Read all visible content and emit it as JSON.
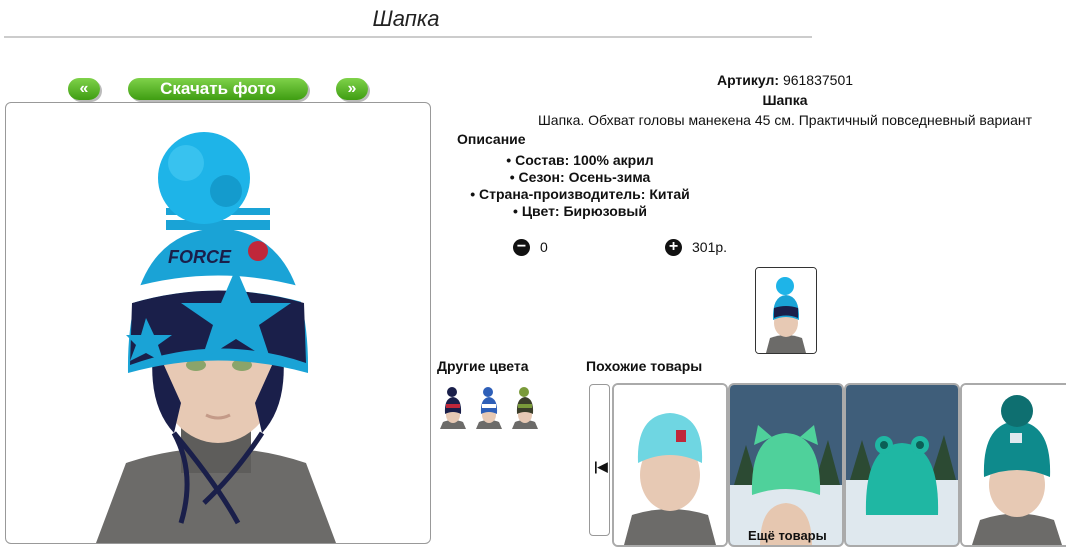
{
  "page": {
    "title": "Шапка"
  },
  "toolbar": {
    "prev_label": "«",
    "download_label": "Скачать фото",
    "next_label": "»"
  },
  "product": {
    "sku_label": "Артикул:",
    "sku_value": "961837501",
    "name": "Шапка",
    "description": "Шапка. Обхват головы манекена 45 см. Практичный повседневный вариант",
    "desc_heading": "Описание",
    "specs": [
      "Состав: 100% акрил",
      "Сезон: Осень-зима",
      "Страна-производитель: Китай",
      "Цвет: Бирюзовый"
    ],
    "quantity": "0",
    "price": "301р.",
    "hat_logo_text": "FORCE",
    "colors": {
      "hat_turquoise": "#1aa3d6",
      "hat_navy": "#1a1f4a"
    }
  },
  "other_colors": {
    "heading": "Другие цвета",
    "swatches": [
      {
        "icon": "hat-red-navy-icon",
        "color": "#c0273a"
      },
      {
        "icon": "hat-blue-icon",
        "color": "#2e5fb8"
      },
      {
        "icon": "hat-green-icon",
        "color": "#7a9a3a"
      }
    ]
  },
  "similar": {
    "heading": "Похожие товары",
    "prev_icon": "chevron-left-bar-icon",
    "prev_glyph": "|◀",
    "more_label": "Ещё товары",
    "cards": [
      {
        "icon": "hat-light-blue-icon",
        "color": "#6fd6e2"
      },
      {
        "icon": "hat-mint-cat-ears-icon",
        "color": "#4fd19b"
      },
      {
        "icon": "hat-teal-frog-icon",
        "color": "#1fb7a3"
      },
      {
        "icon": "hat-teal-pompom-icon",
        "color": "#0e8a8c"
      }
    ]
  }
}
